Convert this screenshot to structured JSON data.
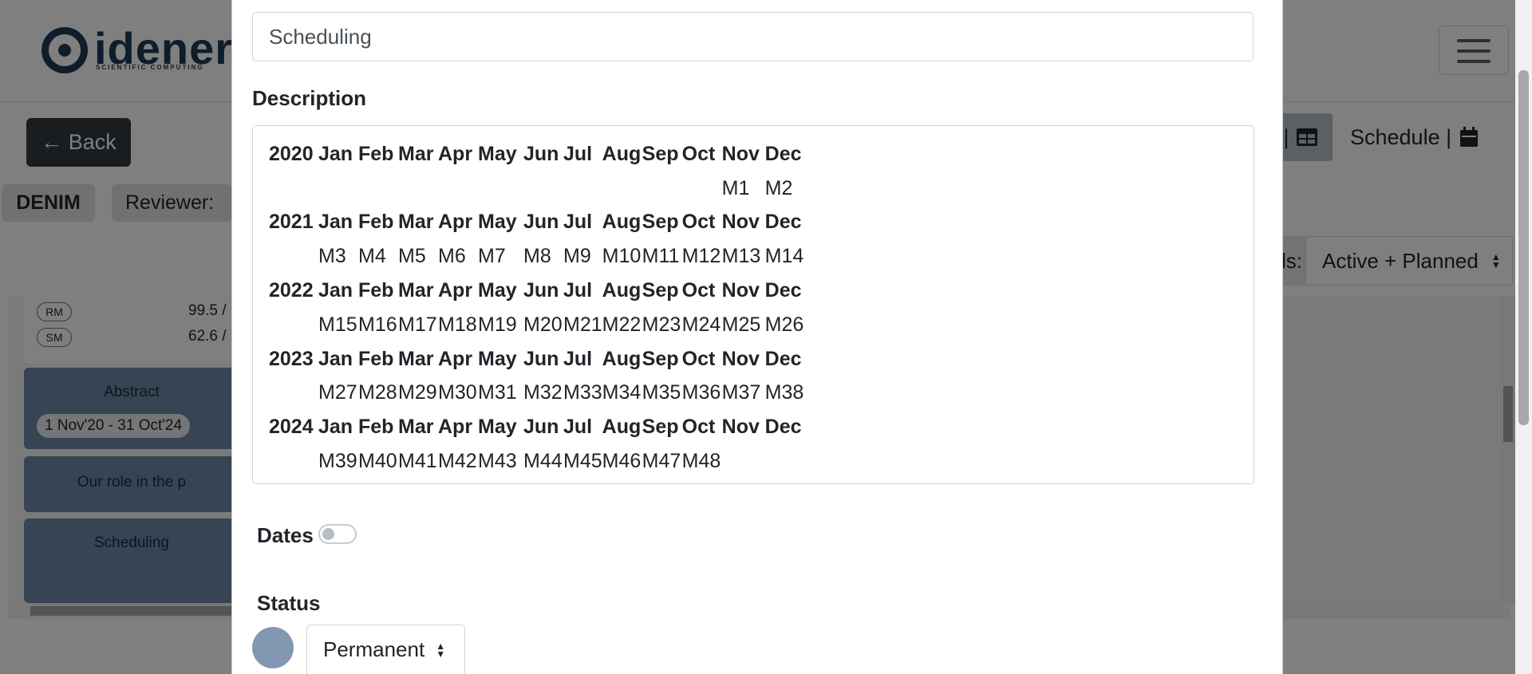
{
  "background": {
    "logo": {
      "word": "idener",
      "subtitle": "SCIENTIFIC COMPUTING"
    },
    "back_button": "← Back",
    "project_tag": "DENIM",
    "reviewer_label": "Reviewer:",
    "view_toggle": "|",
    "schedule_link": "Schedule |",
    "records_label": "ds:",
    "records_select": "Active + Planned",
    "metrics": [
      {
        "pill": "RM",
        "value": "99.5 /"
      },
      {
        "pill": "SM",
        "value": "62.6 /"
      }
    ],
    "tasks": [
      {
        "title": "Abstract",
        "dates": "1 Nov'20 - 31 Oct'24"
      },
      {
        "title": "Our role in the p"
      },
      {
        "title": "Scheduling"
      }
    ]
  },
  "modal": {
    "name_value": "Scheduling",
    "description_label": "Description",
    "schedule": [
      {
        "year": "2020",
        "months": [
          "Jan",
          "Feb",
          "Mar",
          "Apr",
          "May",
          "Jun",
          "Jul",
          "Aug",
          "Sep",
          "Oct",
          "Nov",
          "Dec"
        ],
        "milestones": [
          "",
          "",
          "",
          "",
          "",
          "",
          "",
          "",
          "",
          "",
          "M1",
          "M2"
        ]
      },
      {
        "year": "2021",
        "months": [
          "Jan",
          "Feb",
          "Mar",
          "Apr",
          "May",
          "Jun",
          "Jul",
          "Aug",
          "Sep",
          "Oct",
          "Nov",
          "Dec"
        ],
        "milestones": [
          "M3",
          "M4",
          "M5",
          "M6",
          "M7",
          "M8",
          "M9",
          "M10",
          "M11",
          "M12",
          "M13",
          "M14"
        ]
      },
      {
        "year": "2022",
        "months": [
          "Jan",
          "Feb",
          "Mar",
          "Apr",
          "May",
          "Jun",
          "Jul",
          "Aug",
          "Sep",
          "Oct",
          "Nov",
          "Dec"
        ],
        "milestones": [
          "M15",
          "M16",
          "M17",
          "M18",
          "M19",
          "M20",
          "M21",
          "M22",
          "M23",
          "M24",
          "M25",
          "M26"
        ]
      },
      {
        "year": "2023",
        "months": [
          "Jan",
          "Feb",
          "Mar",
          "Apr",
          "May",
          "Jun",
          "Jul",
          "Aug",
          "Sep",
          "Oct",
          "Nov",
          "Dec"
        ],
        "milestones": [
          "M27",
          "M28",
          "M29",
          "M30",
          "M31",
          "M32",
          "M33",
          "M34",
          "M35",
          "M36",
          "M37",
          "M38"
        ]
      },
      {
        "year": "2024",
        "months": [
          "Jan",
          "Feb",
          "Mar",
          "Apr",
          "May",
          "Jun",
          "Jul",
          "Aug",
          "Sep",
          "Oct",
          "Nov",
          "Dec"
        ],
        "milestones": [
          "M39",
          "M40",
          "M41",
          "M42",
          "M43",
          "M44",
          "M45",
          "M46",
          "M47",
          "M48",
          "",
          ""
        ]
      }
    ],
    "dates_label": "Dates",
    "dates_toggle_on": false,
    "status_label": "Status",
    "status_value": "Permanent",
    "status_color": "#8397b3"
  }
}
